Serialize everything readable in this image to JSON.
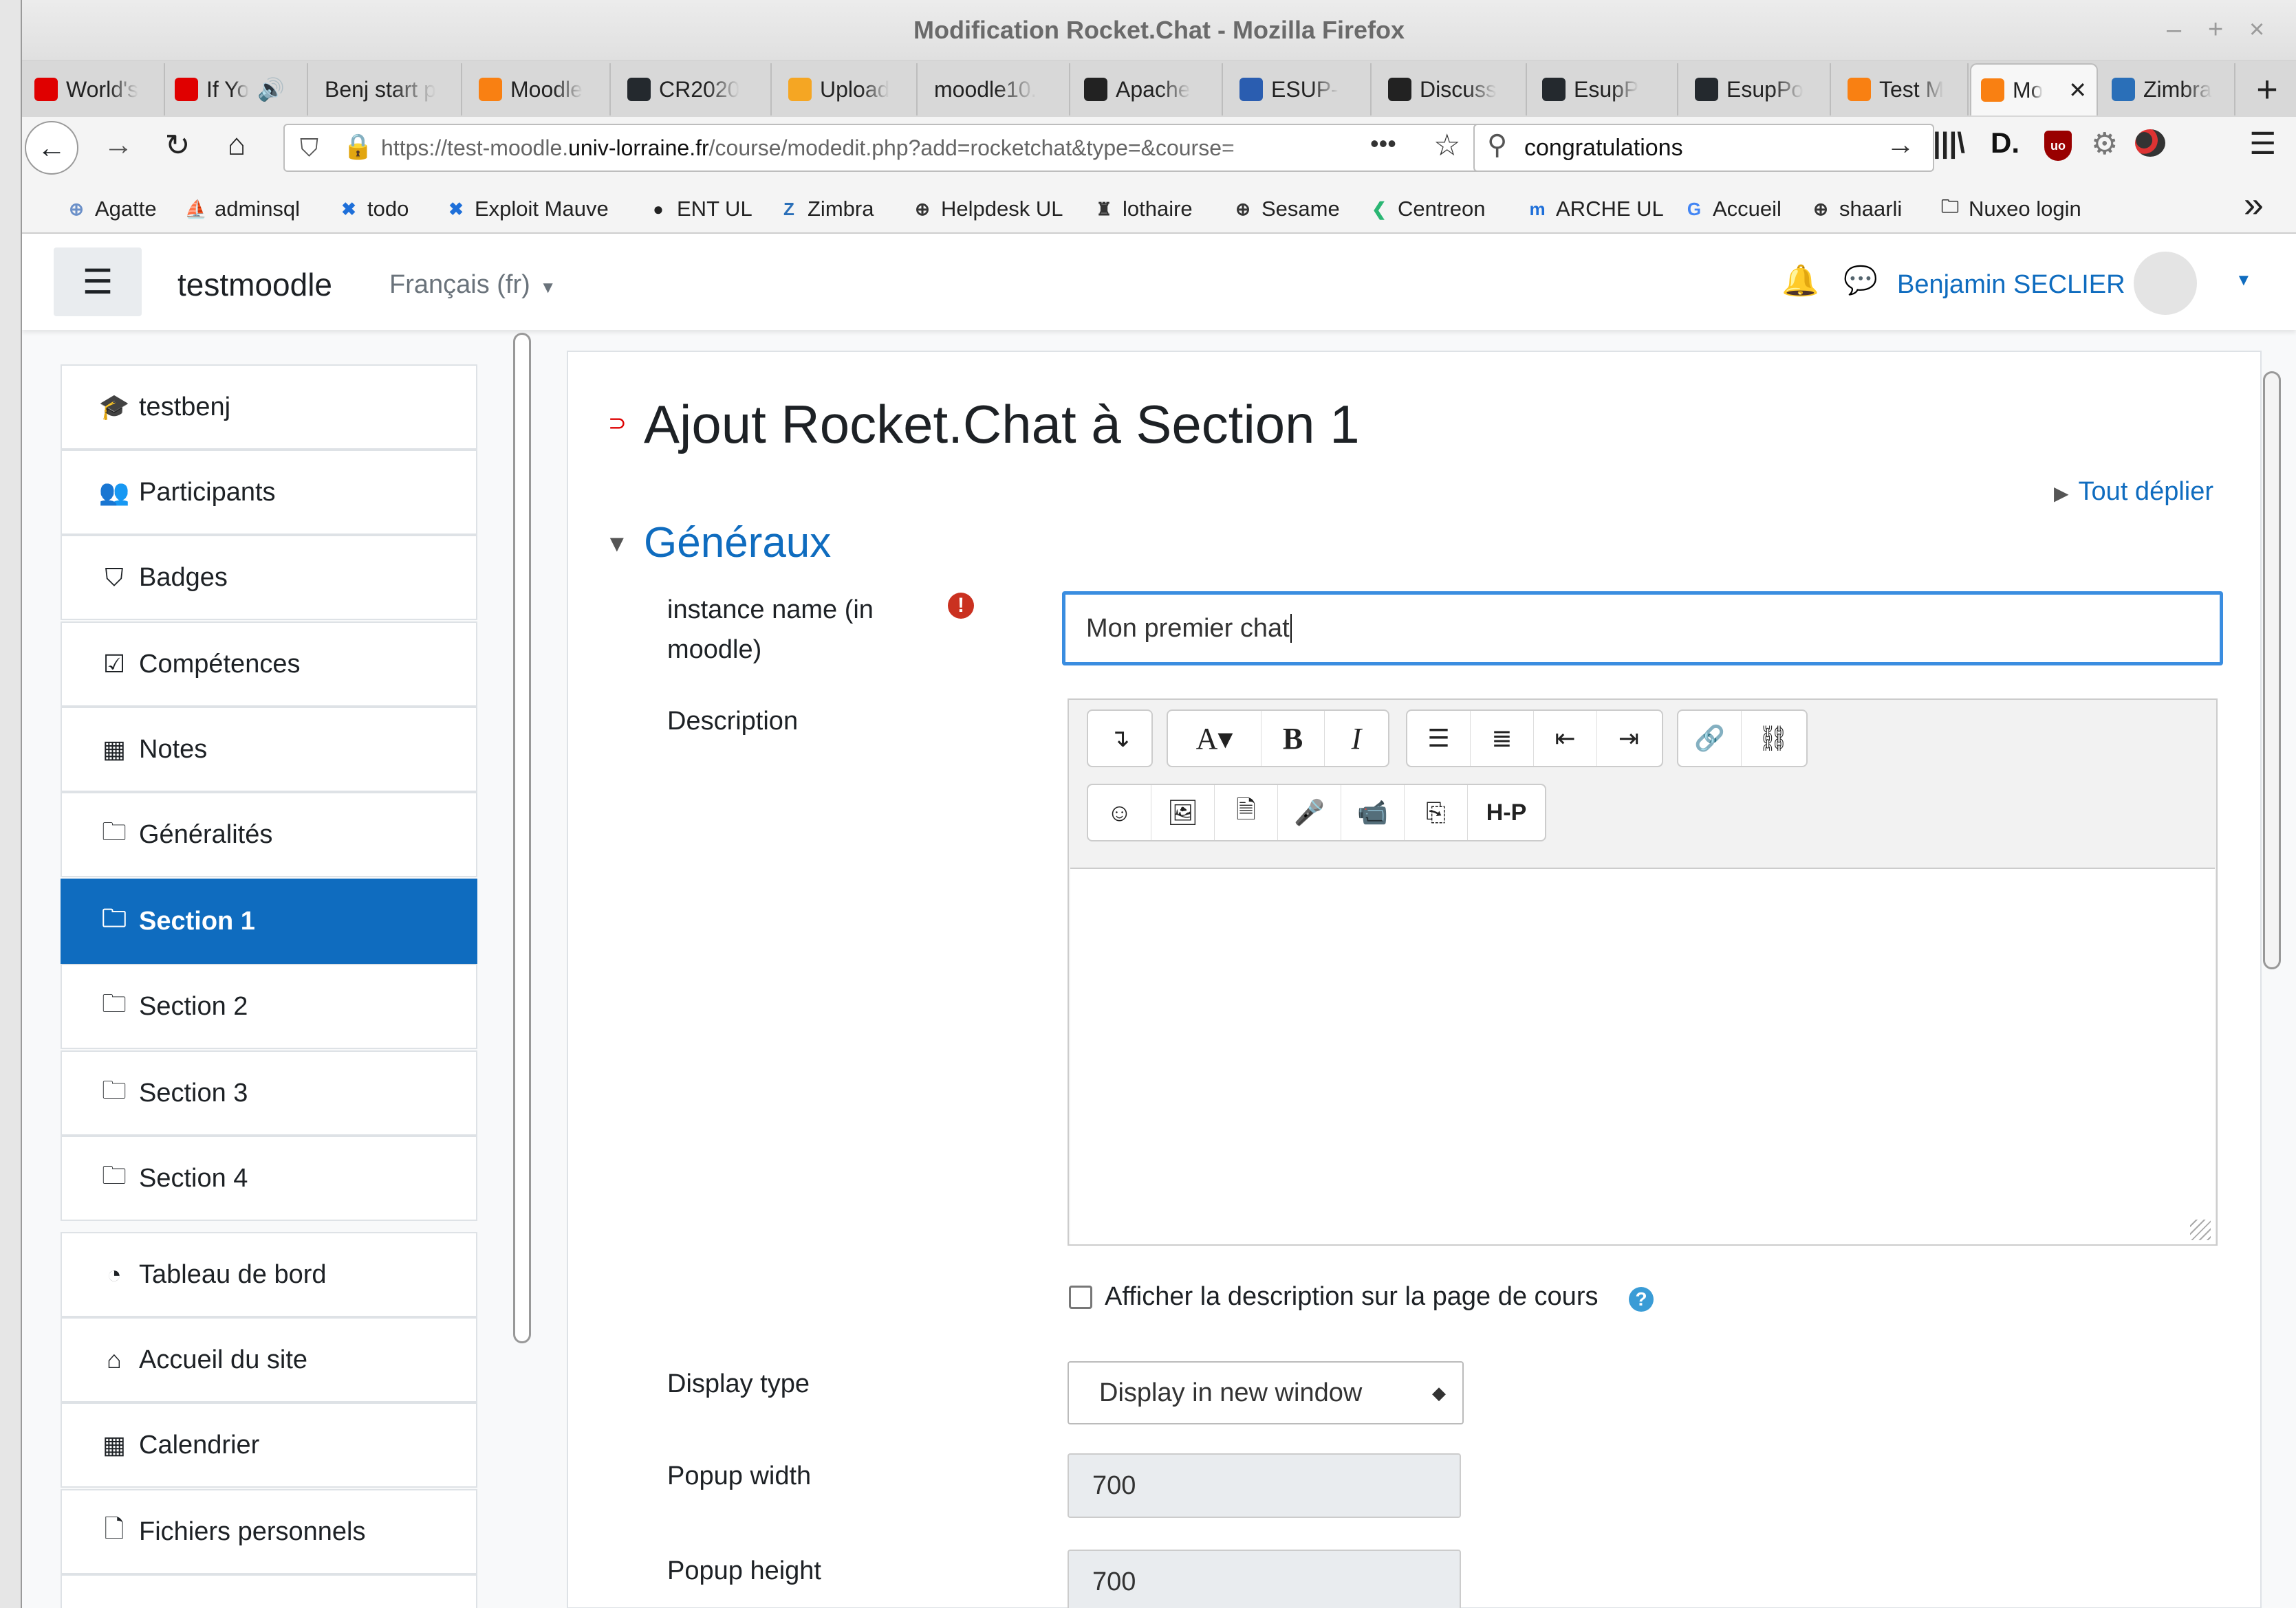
{
  "window": {
    "title": "Modification Rocket.Chat - Mozilla Firefox",
    "controls": [
      "–",
      "+",
      "×"
    ]
  },
  "tabs": [
    {
      "label": "World's",
      "icon": "youtube-icon",
      "color": "#e00000"
    },
    {
      "label": "If Yo",
      "icon": "youtube-icon",
      "color": "#e00000",
      "audio": "🔊"
    },
    {
      "label": "Benj start p",
      "icon": "",
      "color": ""
    },
    {
      "label": "Moodle",
      "icon": "moodle-icon",
      "color": "#f98012"
    },
    {
      "label": "CR2020",
      "icon": "github-icon",
      "color": "#24292e"
    },
    {
      "label": "Upload",
      "icon": "gift-icon",
      "color": "#f5a623"
    },
    {
      "label": "moodle10.",
      "icon": "",
      "color": ""
    },
    {
      "label": "Apache",
      "icon": "ul-icon",
      "color": "#222"
    },
    {
      "label": "ESUP-",
      "icon": "esup-icon",
      "color": "#2a5db0"
    },
    {
      "label": "Discuss",
      "icon": "ul-icon",
      "color": "#222"
    },
    {
      "label": "EsupP",
      "icon": "github-icon",
      "color": "#24292e"
    },
    {
      "label": "EsupPo",
      "icon": "github-icon",
      "color": "#24292e"
    },
    {
      "label": "Test M",
      "icon": "moodle-icon",
      "color": "#f98012"
    },
    {
      "label": "Mo",
      "icon": "moodle-icon",
      "color": "#f98012",
      "active": true
    },
    {
      "label": "Zimbra",
      "icon": "zimbra-icon",
      "color": "#2a6fb8"
    }
  ],
  "new_tab": "+",
  "nav": {
    "url_host_prefix": "https://test-moodle.",
    "url_host": "univ-lorraine.fr",
    "url_path": "/course/modedit.php?add=rocketchat&type=&course=",
    "url_more": "•••",
    "search_value": "congratulations"
  },
  "bookmarks": [
    {
      "label": "Agatte",
      "icon": "globe-icon",
      "color": "#6a8fc8"
    },
    {
      "label": "adminsql",
      "icon": "pma-icon",
      "color": "#f0a000"
    },
    {
      "label": "todo",
      "icon": "x-icon",
      "color": "#1e6fd9"
    },
    {
      "label": "Exploit Mauve",
      "icon": "x-icon",
      "color": "#1e6fd9"
    },
    {
      "label": "ENT UL",
      "icon": "ul-icon",
      "color": "#222"
    },
    {
      "label": "Zimbra",
      "icon": "zimbra-icon",
      "color": "#2a6fb8"
    },
    {
      "label": "Helpdesk UL",
      "icon": "globe-icon",
      "color": "#333"
    },
    {
      "label": "lothaire",
      "icon": "lothaire-icon",
      "color": "#333"
    },
    {
      "label": "Sesame",
      "icon": "globe-icon",
      "color": "#333"
    },
    {
      "label": "Centreon",
      "icon": "centreon-icon",
      "color": "#2ab673"
    },
    {
      "label": "ARCHE UL",
      "icon": "moodle-icon",
      "color": "#1e6fd9"
    },
    {
      "label": "Accueil",
      "icon": "google-icon",
      "color": "#4285f4"
    },
    {
      "label": "shaarli",
      "icon": "globe-icon",
      "color": "#333"
    },
    {
      "label": "Nuxeo login",
      "icon": "folder-icon",
      "color": "#333"
    }
  ],
  "bookmarks_overflow": "»",
  "header": {
    "site_name": "testmoodle",
    "language": "Français (fr)",
    "user_name": "Benjamin SECLIER"
  },
  "drawer": [
    {
      "label": "testbenj",
      "icon": "graduation-cap-icon",
      "glyph": "🎓"
    },
    {
      "label": "Participants",
      "icon": "users-icon",
      "glyph": "👥"
    },
    {
      "label": "Badges",
      "icon": "shield-icon",
      "glyph": "⛉"
    },
    {
      "label": "Compétences",
      "icon": "checkbox-icon",
      "glyph": "☑"
    },
    {
      "label": "Notes",
      "icon": "table-icon",
      "glyph": "▦"
    },
    {
      "label": "Généralités",
      "icon": "folder-icon",
      "glyph": "🗀"
    },
    {
      "label": "Section 1",
      "icon": "folder-icon",
      "glyph": "🗀",
      "active": true
    },
    {
      "label": "Section 2",
      "icon": "folder-icon",
      "glyph": "🗀"
    },
    {
      "label": "Section 3",
      "icon": "folder-icon",
      "glyph": "🗀"
    },
    {
      "label": "Section 4",
      "icon": "folder-icon",
      "glyph": "🗀"
    },
    {
      "label": "Tableau de bord",
      "icon": "dashboard-icon",
      "glyph": "◔"
    },
    {
      "label": "Accueil du site",
      "icon": "home-icon",
      "glyph": "⌂"
    },
    {
      "label": "Calendrier",
      "icon": "calendar-icon",
      "glyph": "▦"
    },
    {
      "label": "Fichiers personnels",
      "icon": "file-icon",
      "glyph": "🗋"
    }
  ],
  "main": {
    "heading": "Ajout Rocket.Chat à Section 1",
    "expand_all": "Tout déplier",
    "section_title": "Généraux",
    "instance_label": "instance name (in moodle)",
    "instance_value": "Mon premier chat",
    "description_label": "Description",
    "show_description_label": "Afficher la description sur la page de cours",
    "display_type_label": "Display type",
    "display_type_value": "Display in new window",
    "popup_width_label": "Popup width",
    "popup_width_value": "700",
    "popup_height_label": "Popup height",
    "popup_height_value": "700"
  },
  "colors": {
    "accent": "#0f6cbf",
    "required": "#ca3120",
    "focus": "#3a8de0"
  }
}
